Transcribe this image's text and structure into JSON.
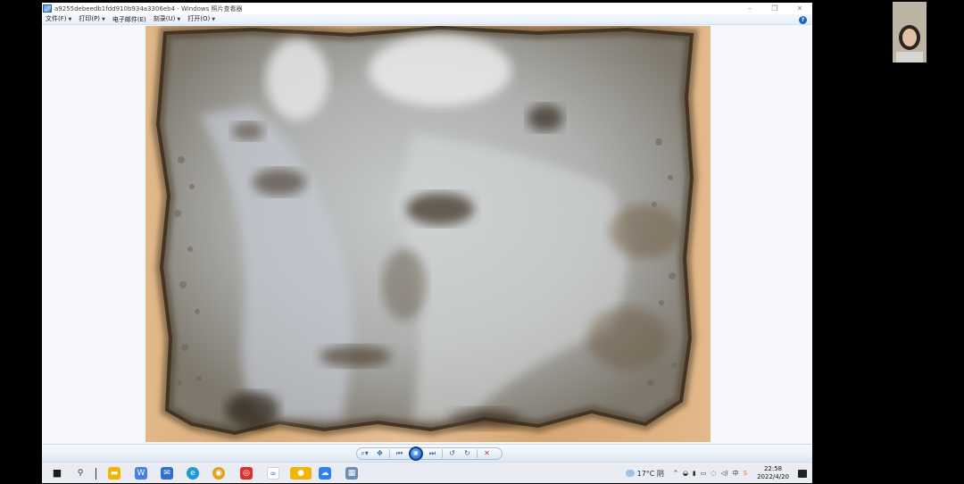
{
  "window": {
    "title": "a9255debeedb1fdd910b934a3306eb4 - Windows 照片查看器",
    "help_label": "?"
  },
  "menu": [
    {
      "label": "文件(F)",
      "has_caret": true
    },
    {
      "label": "打印(P)",
      "has_caret": true
    },
    {
      "label": "电子邮件(E)",
      "has_caret": false
    },
    {
      "label": "刻录(U)",
      "has_caret": true
    },
    {
      "label": "打开(O)",
      "has_caret": true
    }
  ],
  "toolbar": {
    "zoom_icon": "zoom-icon",
    "fit_icon": "fit-to-window-icon",
    "prev_icon": "previous-icon",
    "slideshow_icon": "slideshow-icon",
    "next_icon": "next-icon",
    "rotate_ccw_icon": "rotate-counterclockwise-icon",
    "rotate_cw_icon": "rotate-clockwise-icon",
    "delete_icon": "delete-icon"
  },
  "taskbar": {
    "apps": [
      "file-explorer-icon",
      "wps-icon",
      "mail-icon",
      "edge-icon",
      "chrome-icon",
      "netease-music-icon",
      "app-icon",
      "wechat-icon",
      "baidu-netdisk-icon",
      "photo-viewer-icon"
    ],
    "weather": "17°C 阴",
    "time": "22:58",
    "date": "2022/4/20"
  },
  "colors": {
    "accent": "#1e64c8",
    "delete": "#d43030",
    "taskbar_bg": "#e9edf3"
  }
}
